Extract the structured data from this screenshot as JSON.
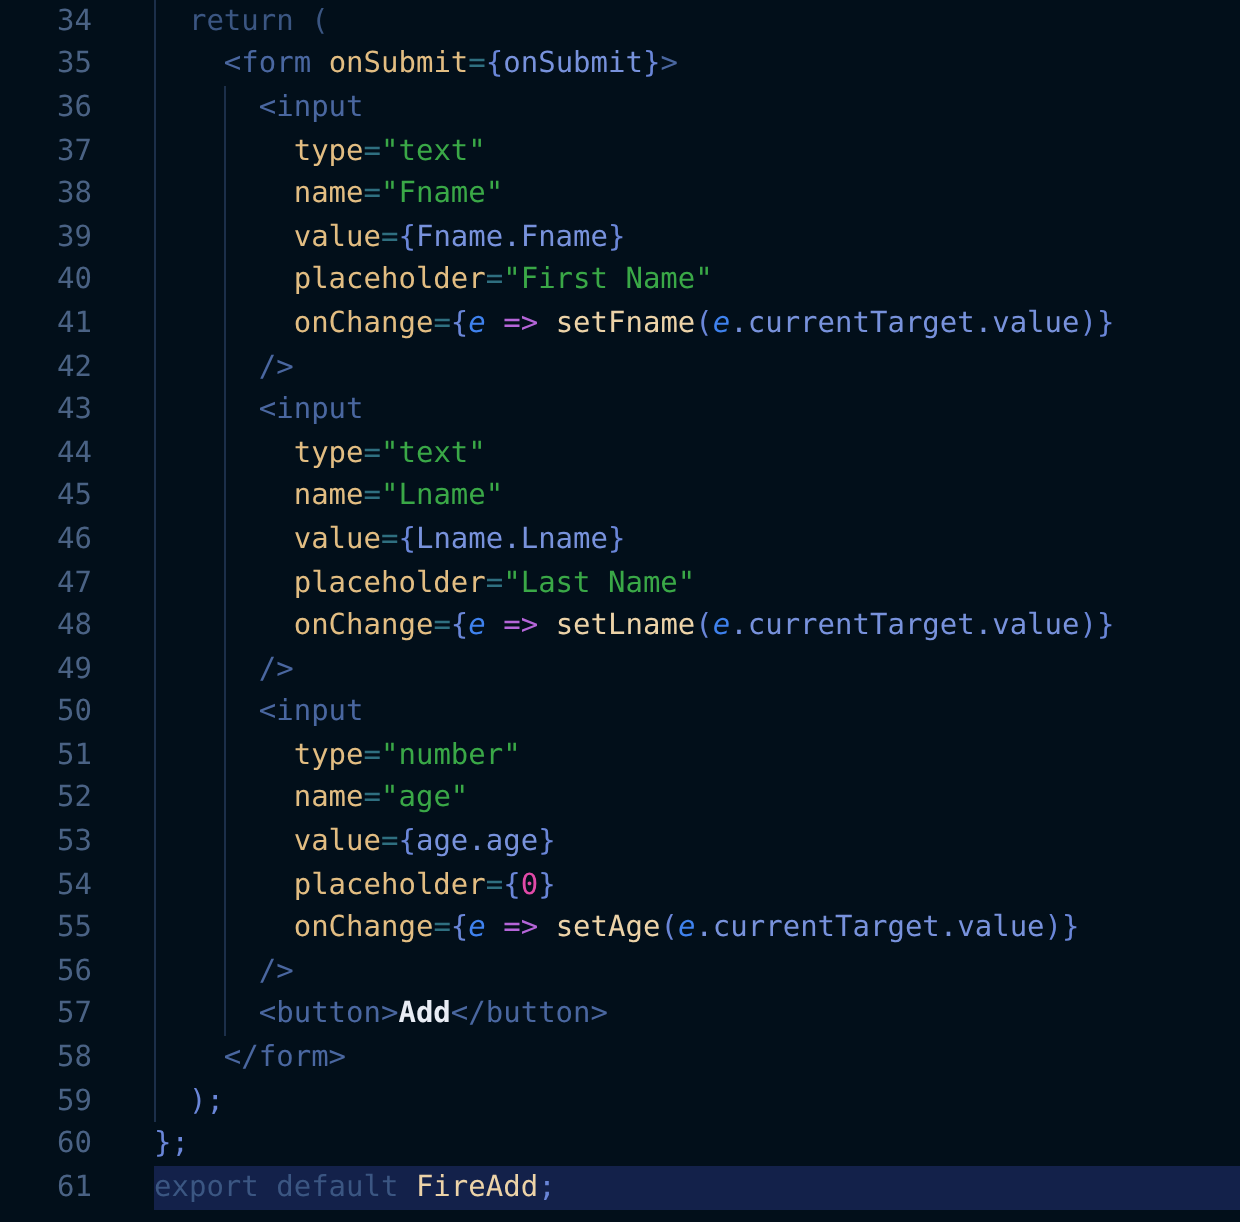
{
  "editor": {
    "lines": [
      {
        "number": "34",
        "highlighted": false,
        "tokens": [
          {
            "kind": "keyword",
            "text": "  return ("
          }
        ]
      },
      {
        "number": "35",
        "highlighted": false,
        "tokens": [
          {
            "kind": "tag",
            "text": "    <form "
          },
          {
            "kind": "attr",
            "text": "onSubmit"
          },
          {
            "kind": "op",
            "text": "="
          },
          {
            "kind": "brace",
            "text": "{"
          },
          {
            "kind": "var",
            "text": "onSubmit"
          },
          {
            "kind": "brace",
            "text": "}"
          },
          {
            "kind": "tag",
            "text": ">"
          }
        ]
      },
      {
        "number": "36",
        "highlighted": false,
        "tokens": [
          {
            "kind": "tag",
            "text": "      <input"
          }
        ]
      },
      {
        "number": "37",
        "highlighted": false,
        "tokens": [
          {
            "kind": "attr",
            "text": "        type"
          },
          {
            "kind": "op",
            "text": "="
          },
          {
            "kind": "string",
            "text": "\"text\""
          }
        ]
      },
      {
        "number": "38",
        "highlighted": false,
        "tokens": [
          {
            "kind": "attr",
            "text": "        name"
          },
          {
            "kind": "op",
            "text": "="
          },
          {
            "kind": "string",
            "text": "\"Fname\""
          }
        ]
      },
      {
        "number": "39",
        "highlighted": false,
        "tokens": [
          {
            "kind": "attr",
            "text": "        value"
          },
          {
            "kind": "op",
            "text": "="
          },
          {
            "kind": "brace",
            "text": "{"
          },
          {
            "kind": "var",
            "text": "Fname.Fname"
          },
          {
            "kind": "brace",
            "text": "}"
          }
        ]
      },
      {
        "number": "40",
        "highlighted": false,
        "tokens": [
          {
            "kind": "attr",
            "text": "        placeholder"
          },
          {
            "kind": "op",
            "text": "="
          },
          {
            "kind": "string",
            "text": "\"First Name\""
          }
        ]
      },
      {
        "number": "41",
        "highlighted": false,
        "tokens": [
          {
            "kind": "attr",
            "text": "        onChange"
          },
          {
            "kind": "op",
            "text": "="
          },
          {
            "kind": "brace",
            "text": "{"
          },
          {
            "kind": "param",
            "text": "e "
          },
          {
            "kind": "arrow",
            "text": "=> "
          },
          {
            "kind": "func",
            "text": "setFname"
          },
          {
            "kind": "brace",
            "text": "("
          },
          {
            "kind": "param",
            "text": "e"
          },
          {
            "kind": "var",
            "text": ".currentTarget.value"
          },
          {
            "kind": "brace",
            "text": ")}"
          }
        ]
      },
      {
        "number": "42",
        "highlighted": false,
        "tokens": [
          {
            "kind": "tag",
            "text": "      />"
          }
        ]
      },
      {
        "number": "43",
        "highlighted": false,
        "tokens": [
          {
            "kind": "tag",
            "text": "      <input"
          }
        ]
      },
      {
        "number": "44",
        "highlighted": false,
        "tokens": [
          {
            "kind": "attr",
            "text": "        type"
          },
          {
            "kind": "op",
            "text": "="
          },
          {
            "kind": "string",
            "text": "\"text\""
          }
        ]
      },
      {
        "number": "45",
        "highlighted": false,
        "tokens": [
          {
            "kind": "attr",
            "text": "        name"
          },
          {
            "kind": "op",
            "text": "="
          },
          {
            "kind": "string",
            "text": "\"Lname\""
          }
        ]
      },
      {
        "number": "46",
        "highlighted": false,
        "tokens": [
          {
            "kind": "attr",
            "text": "        value"
          },
          {
            "kind": "op",
            "text": "="
          },
          {
            "kind": "brace",
            "text": "{"
          },
          {
            "kind": "var",
            "text": "Lname.Lname"
          },
          {
            "kind": "brace",
            "text": "}"
          }
        ]
      },
      {
        "number": "47",
        "highlighted": false,
        "tokens": [
          {
            "kind": "attr",
            "text": "        placeholder"
          },
          {
            "kind": "op",
            "text": "="
          },
          {
            "kind": "string",
            "text": "\"Last Name\""
          }
        ]
      },
      {
        "number": "48",
        "highlighted": false,
        "tokens": [
          {
            "kind": "attr",
            "text": "        onChange"
          },
          {
            "kind": "op",
            "text": "="
          },
          {
            "kind": "brace",
            "text": "{"
          },
          {
            "kind": "param",
            "text": "e "
          },
          {
            "kind": "arrow",
            "text": "=> "
          },
          {
            "kind": "func",
            "text": "setLname"
          },
          {
            "kind": "brace",
            "text": "("
          },
          {
            "kind": "param",
            "text": "e"
          },
          {
            "kind": "var",
            "text": ".currentTarget.value"
          },
          {
            "kind": "brace",
            "text": ")}"
          }
        ]
      },
      {
        "number": "49",
        "highlighted": false,
        "tokens": [
          {
            "kind": "tag",
            "text": "      />"
          }
        ]
      },
      {
        "number": "50",
        "highlighted": false,
        "tokens": [
          {
            "kind": "tag",
            "text": "      <input"
          }
        ]
      },
      {
        "number": "51",
        "highlighted": false,
        "tokens": [
          {
            "kind": "attr",
            "text": "        type"
          },
          {
            "kind": "op",
            "text": "="
          },
          {
            "kind": "string",
            "text": "\"number\""
          }
        ]
      },
      {
        "number": "52",
        "highlighted": false,
        "tokens": [
          {
            "kind": "attr",
            "text": "        name"
          },
          {
            "kind": "op",
            "text": "="
          },
          {
            "kind": "string",
            "text": "\"age\""
          }
        ]
      },
      {
        "number": "53",
        "highlighted": false,
        "tokens": [
          {
            "kind": "attr",
            "text": "        value"
          },
          {
            "kind": "op",
            "text": "="
          },
          {
            "kind": "brace",
            "text": "{"
          },
          {
            "kind": "var",
            "text": "age.age"
          },
          {
            "kind": "brace",
            "text": "}"
          }
        ]
      },
      {
        "number": "54",
        "highlighted": false,
        "tokens": [
          {
            "kind": "attr",
            "text": "        placeholder"
          },
          {
            "kind": "op",
            "text": "="
          },
          {
            "kind": "brace",
            "text": "{"
          },
          {
            "kind": "number",
            "text": "0"
          },
          {
            "kind": "brace",
            "text": "}"
          }
        ]
      },
      {
        "number": "55",
        "highlighted": false,
        "tokens": [
          {
            "kind": "attr",
            "text": "        onChange"
          },
          {
            "kind": "op",
            "text": "="
          },
          {
            "kind": "brace",
            "text": "{"
          },
          {
            "kind": "param",
            "text": "e "
          },
          {
            "kind": "arrow",
            "text": "=> "
          },
          {
            "kind": "func",
            "text": "setAge"
          },
          {
            "kind": "brace",
            "text": "("
          },
          {
            "kind": "param",
            "text": "e"
          },
          {
            "kind": "var",
            "text": ".currentTarget.value"
          },
          {
            "kind": "brace",
            "text": ")}"
          }
        ]
      },
      {
        "number": "56",
        "highlighted": false,
        "tokens": [
          {
            "kind": "tag",
            "text": "      />"
          }
        ]
      },
      {
        "number": "57",
        "highlighted": false,
        "tokens": [
          {
            "kind": "tag",
            "text": "      <button>"
          },
          {
            "kind": "text",
            "text": "Add"
          },
          {
            "kind": "tag",
            "text": "</button>"
          }
        ]
      },
      {
        "number": "58",
        "highlighted": false,
        "tokens": [
          {
            "kind": "tag",
            "text": "    </form>"
          }
        ]
      },
      {
        "number": "59",
        "highlighted": false,
        "tokens": [
          {
            "kind": "brace",
            "text": "  );"
          }
        ]
      },
      {
        "number": "60",
        "highlighted": false,
        "tokens": [
          {
            "kind": "brace",
            "text": "};"
          }
        ]
      },
      {
        "number": "61",
        "highlighted": true,
        "tokens": [
          {
            "kind": "keyword",
            "text": "export default "
          },
          {
            "kind": "func",
            "text": "FireAdd"
          },
          {
            "kind": "brace",
            "text": ";"
          }
        ]
      }
    ]
  }
}
